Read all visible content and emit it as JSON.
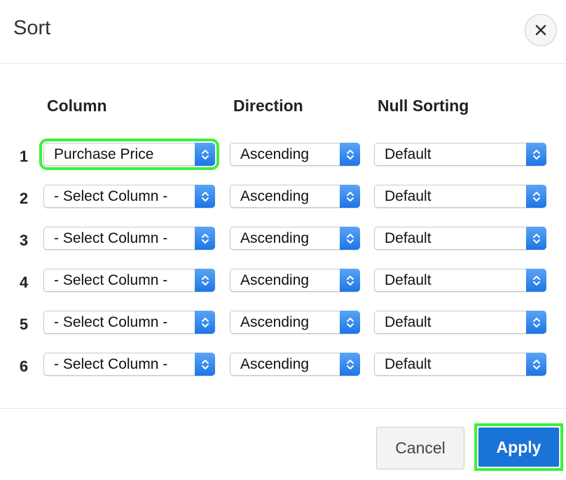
{
  "dialog": {
    "title": "Sort",
    "close_icon": "close-icon"
  },
  "headers": {
    "column": "Column",
    "direction": "Direction",
    "null_sorting": "Null Sorting"
  },
  "rows": [
    {
      "num": "1",
      "column": "Purchase Price",
      "direction": "Ascending",
      "null_sorting": "Default"
    },
    {
      "num": "2",
      "column": "- Select Column -",
      "direction": "Ascending",
      "null_sorting": "Default"
    },
    {
      "num": "3",
      "column": "- Select Column -",
      "direction": "Ascending",
      "null_sorting": "Default"
    },
    {
      "num": "4",
      "column": "- Select Column -",
      "direction": "Ascending",
      "null_sorting": "Default"
    },
    {
      "num": "5",
      "column": "- Select Column -",
      "direction": "Ascending",
      "null_sorting": "Default"
    },
    {
      "num": "6",
      "column": "- Select Column -",
      "direction": "Ascending",
      "null_sorting": "Default"
    }
  ],
  "buttons": {
    "cancel": "Cancel",
    "apply": "Apply"
  },
  "colors": {
    "accent": "#1a73d6",
    "highlight": "#3bf23b"
  }
}
